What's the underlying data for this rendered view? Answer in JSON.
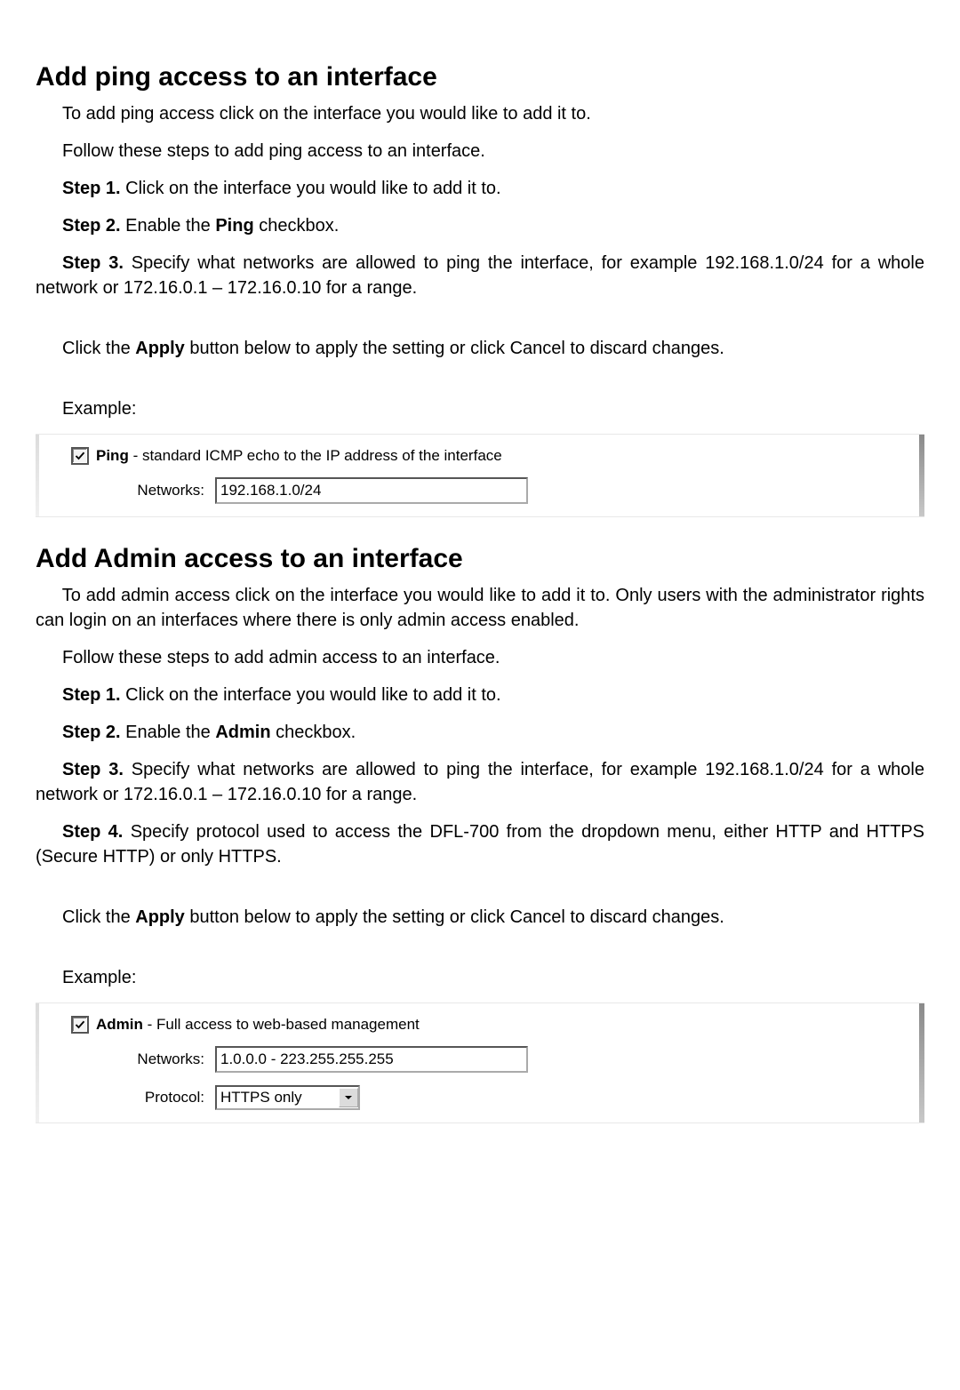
{
  "section1": {
    "title": "Add ping access to an interface",
    "intro": "To add ping access click on the interface you would like to add it to.",
    "follow": "Follow these steps to add ping access to an interface.",
    "steps": [
      {
        "label": "Step 1.",
        "text": " Click on the interface you would like to add it to."
      },
      {
        "label": "Step 2.",
        "text_pre": " Enable the ",
        "bold": "Ping",
        "text_post": " checkbox."
      },
      {
        "label": "Step 3.",
        "text": " Specify what networks are allowed to ping the interface, for example 192.168.1.0/24 for a whole network or 172.16.0.1 – 172.16.0.10 for a range."
      }
    ],
    "apply_pre": "Click the ",
    "apply_bold": "Apply",
    "apply_post": " button below to apply the setting or click Cancel to discard changes.",
    "example_label": "Example:",
    "ping_check_label": "Ping",
    "ping_check_desc": " - standard ICMP echo to the IP address of the interface",
    "networks_label": "Networks:",
    "networks_value": "192.168.1.0/24"
  },
  "section2": {
    "title": "Add Admin access to an interface",
    "intro": "To add admin access click on the interface you would like to add it to. Only users with the administrator rights can login on an interfaces where there is only admin access enabled.",
    "follow": "Follow these steps to add admin access to an interface.",
    "steps": [
      {
        "label": "Step 1.",
        "text": " Click on the interface you would like to add it to."
      },
      {
        "label": "Step 2.",
        "text_pre": " Enable the ",
        "bold": "Admin",
        "text_post": " checkbox."
      },
      {
        "label": "Step 3.",
        "text": " Specify what networks are allowed to ping the interface, for example 192.168.1.0/24 for a whole network or 172.16.0.1 – 172.16.0.10 for a range."
      },
      {
        "label": "Step 4.",
        "text": " Specify protocol used to access the DFL-700 from the dropdown menu, either HTTP and HTTPS (Secure HTTP) or only HTTPS."
      }
    ],
    "apply_pre": "Click the ",
    "apply_bold": "Apply",
    "apply_post": " button below to apply the setting or click Cancel to discard changes.",
    "example_label": "Example:",
    "admin_check_label": "Admin",
    "admin_check_desc": " - Full access to web-based management",
    "networks_label": "Networks:",
    "networks_value": "1.0.0.0 - 223.255.255.255",
    "protocol_label": "Protocol:",
    "protocol_value": "HTTPS only"
  }
}
